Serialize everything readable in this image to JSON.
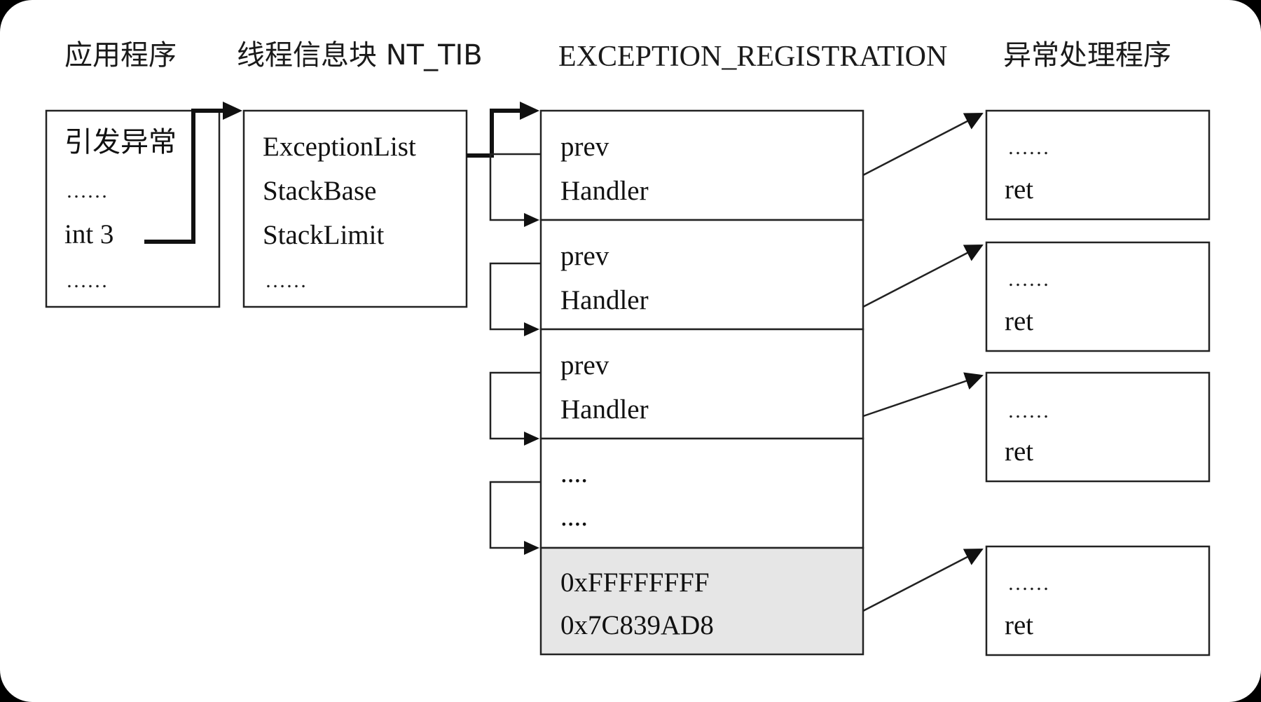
{
  "headers": {
    "app": "应用程序",
    "tib": "线程信息块 NT_TIB",
    "reg": "EXCEPTION_REGISTRATION",
    "handler": "异常处理程序"
  },
  "app_box": {
    "line1": "引发异常",
    "line2": "……",
    "line3": "int 3",
    "line4": "……"
  },
  "tib_box": {
    "field1": "ExceptionList",
    "field2": "StackBase",
    "field3": "StackLimit",
    "field4": "……"
  },
  "registrations": [
    {
      "prev": "prev",
      "handler": "Handler"
    },
    {
      "prev": "prev",
      "handler": "Handler"
    },
    {
      "prev": "prev",
      "handler": "Handler"
    },
    {
      "prev": "....",
      "handler": "...."
    },
    {
      "prev": "0xFFFFFFFF",
      "handler": "0x7C839AD8"
    }
  ],
  "handlers": [
    {
      "dots": "……",
      "ret": "ret"
    },
    {
      "dots": "……",
      "ret": "ret"
    },
    {
      "dots": "……",
      "ret": "ret"
    },
    {
      "dots": "……",
      "ret": "ret"
    }
  ]
}
